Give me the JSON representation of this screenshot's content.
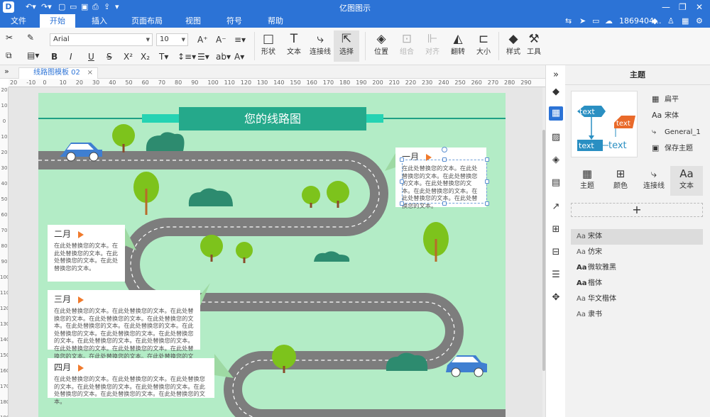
{
  "titlebar": {
    "app_title": "亿图图示"
  },
  "menu": {
    "items": [
      "文件",
      "开始",
      "插入",
      "页面布局",
      "视图",
      "符号",
      "帮助"
    ],
    "active": "开始",
    "user": "1869404..."
  },
  "ribbon": {
    "font_family": "Arial",
    "font_size": "10",
    "buttons": {
      "shape": "形状",
      "text": "文本",
      "connector": "连接线",
      "select": "选择",
      "position": "位置",
      "group": "组合",
      "align": "对齐",
      "flip": "翻转",
      "size": "大小",
      "style": "样式",
      "tools": "工具"
    }
  },
  "doc_tab": {
    "label": "线路图模板 02"
  },
  "ruler": {
    "h": [
      "20",
      "-10",
      "0",
      "10",
      "20",
      "30",
      "40",
      "50",
      "60",
      "70",
      "80",
      "90",
      "100",
      "110",
      "120",
      "130",
      "140",
      "150",
      "160",
      "170",
      "180",
      "190",
      "200",
      "210",
      "220",
      "230",
      "240",
      "250",
      "260",
      "270",
      "280",
      "290"
    ],
    "v": [
      "20",
      "10",
      "0",
      "10",
      "20",
      "30",
      "40",
      "50",
      "60",
      "70",
      "80",
      "90",
      "100",
      "110",
      "120",
      "130",
      "140",
      "150",
      "160",
      "170",
      "180",
      "190"
    ]
  },
  "canvas": {
    "title": "您的线路图",
    "cards": [
      {
        "month": "一月",
        "text": "在此处替换您的文本。在此处替换您的文本。在此处替换您的文本。在此处替换您的文本。在此处替换您的文本。在此处替换您的文本。在此处替换您的文本。"
      },
      {
        "month": "二月",
        "text": "在此处替换您的文本。在此处替换您的文本。在此处替换您的文本。在此处替换您的文本。"
      },
      {
        "month": "三月",
        "text": "在此处替换您的文本。在此处替换您的文本。在此处替换您的文本。在此处替换您的文本。在此处替换您的文本。在此处替换您的文本。在此处替换您的文本。在此处替换您的文本。在此处替换您的文本。在此处替换您的文本。在此处替换您的文本。在此处替换您的文本。在此处替换您的文本。在此处替换您的文本。在此处替换您的文本。在此处替换您的文本。在此处替换您的文本。在此处替换您的文本。在此处替换您的文本。在此处替换您的文本。"
      },
      {
        "month": "四月",
        "text": "在此处替换您的文本。在此处替换您的文本。在此处替换您的文本。在此处替换您的文本。在此处替换您的文本。在此处替换您的文本。在此处替换您的文本。在此处替换您的文本。"
      }
    ]
  },
  "panel": {
    "header": "主题",
    "preview_texts": [
      "text",
      "text",
      "text",
      "text"
    ],
    "theme_options": [
      "扁平",
      "宋体",
      "General_1",
      "保存主题"
    ],
    "tabs": [
      "主题",
      "颜色",
      "连接线",
      "文本"
    ],
    "add": "+",
    "fonts": [
      "宋体",
      "仿宋",
      "微软雅黑",
      "楷体",
      "华文楷体",
      "隶书"
    ],
    "font_prefix": "Aa"
  },
  "colors": {
    "accent": "#2c73d6",
    "canvas_bg": "#b3ecc6",
    "road": "#7d7d7d",
    "banner": "#25a98b",
    "arrow": "#f07a2c"
  }
}
